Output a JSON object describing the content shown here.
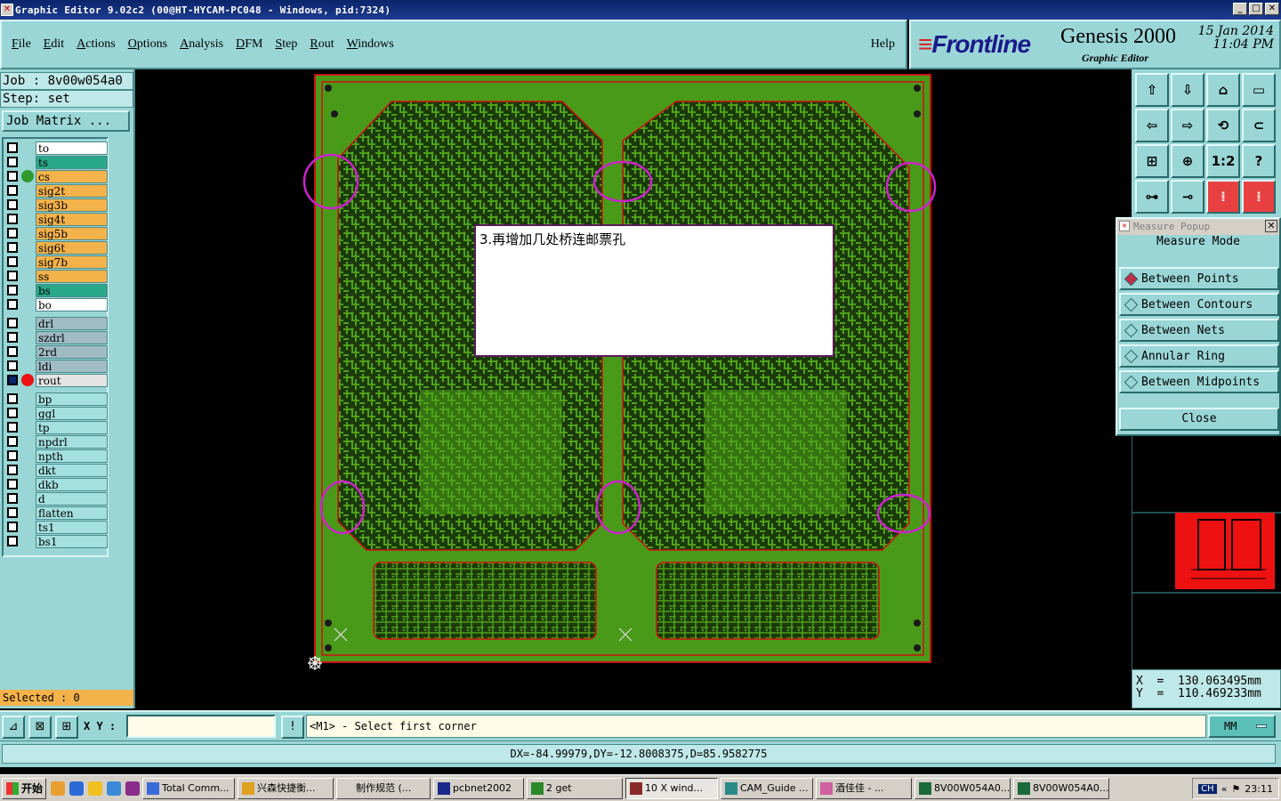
{
  "window": {
    "title": "Graphic Editor 9.02c2 (00@HT-HYCAM-PC048 - Windows, pid:7324)",
    "buttons": [
      "_",
      "□",
      "✕"
    ]
  },
  "menu": {
    "items": [
      "File",
      "Edit",
      "Actions",
      "Options",
      "Analysis",
      "DFM",
      "Step",
      "Rout",
      "Windows"
    ],
    "help": "Help"
  },
  "brand": {
    "logo": "Frontline",
    "product": "Genesis 2000",
    "subtitle": "Graphic Editor",
    "date": "15 Jan 2014",
    "time": "11:04 PM"
  },
  "job": {
    "job_line": "Job : 8v00w054a0",
    "step_line": "Step: set",
    "matrix_button": "Job Matrix ...",
    "selected": "Selected : 0"
  },
  "layers": [
    {
      "name": "to",
      "color": "#ffffff"
    },
    {
      "name": "ts",
      "color": "#2aa88a"
    },
    {
      "name": "cs",
      "color": "#f4b24a",
      "dot": "#2e9a2e"
    },
    {
      "name": "sig2t",
      "color": "#f4b24a"
    },
    {
      "name": "sig3b",
      "color": "#f4b24a"
    },
    {
      "name": "sig4t",
      "color": "#f4b24a"
    },
    {
      "name": "sig5b",
      "color": "#f4b24a"
    },
    {
      "name": "sig6t",
      "color": "#f4b24a"
    },
    {
      "name": "sig7b",
      "color": "#f4b24a"
    },
    {
      "name": "ss",
      "color": "#f4b24a"
    },
    {
      "name": "bs",
      "color": "#2aa88a"
    },
    {
      "name": "bo",
      "color": "#ffffff"
    },
    {
      "name": "drl",
      "color": "#9fbcc4"
    },
    {
      "name": "szdrl",
      "color": "#9fbcc4"
    },
    {
      "name": "2rd",
      "color": "#9fbcc4"
    },
    {
      "name": "ldi",
      "color": "#9fbcc4"
    },
    {
      "name": "rout",
      "color": "#e4e4e4",
      "dot": "#ee1111",
      "checked": true
    },
    {
      "name": "bp",
      "color": "#a4e0e0"
    },
    {
      "name": "ggl",
      "color": "#a4e0e0"
    },
    {
      "name": "tp",
      "color": "#a4e0e0"
    },
    {
      "name": "npdrl",
      "color": "#a4e0e0"
    },
    {
      "name": "npth",
      "color": "#a4e0e0"
    },
    {
      "name": "dkt",
      "color": "#a4e0e0"
    },
    {
      "name": "dkb",
      "color": "#a4e0e0"
    },
    {
      "name": "d",
      "color": "#a4e0e0"
    },
    {
      "name": "flatten",
      "color": "#a4e0e0"
    },
    {
      "name": "ts1",
      "color": "#a4e0e0"
    },
    {
      "name": "bs1",
      "color": "#a4e0e0"
    }
  ],
  "note": {
    "text": "3.再增加几处桥连邮票孔"
  },
  "toolbar_icons": [
    "zoom-home-icon",
    "zoom-in-icon",
    "zoom-fit-icon",
    "zoom-window-icon",
    "pan-left-icon",
    "pan-right-icon",
    "redraw-icon",
    "snap-icon",
    "fill-icon",
    "center-icon",
    "scale-icon",
    "help-icon",
    "measure-icon",
    "key-icon",
    "net-icon",
    "net-alt-icon"
  ],
  "toolbar_glyphs": [
    "⇧",
    "⇩",
    "⌂",
    "▭",
    "⇦",
    "⇨",
    "⟲",
    "⊂",
    "⊞",
    "⊕",
    "1:2",
    "?",
    "⊶",
    "⊸",
    "⁞",
    "⁞"
  ],
  "measure": {
    "title": "Measure Popup",
    "mode_label": "Measure Mode",
    "options": [
      "Between Points",
      "Between Contours",
      "Between Nets",
      "Annular Ring",
      "Between Midpoints"
    ],
    "selected_option": "Between Points",
    "close": "Close"
  },
  "coords": {
    "x_line": "X  =  130.063495mm",
    "y_line": "Y  =  110.469233mm"
  },
  "status": {
    "xy_label": "X Y :",
    "xy_value": "",
    "prompt_icon": "!",
    "prompt": "<M1> - Select first corner",
    "units": "MM",
    "measure_result": "DX=-84.99979,DY=-12.8008375,D=85.9582775"
  },
  "taskbar": {
    "start": "开始",
    "tasks": [
      "Total Comm...",
      "兴森快捷衡...",
      "制作规范 (...",
      "pcbnet2002",
      "2 get",
      "10 X wind...",
      "CAM_Guide ...",
      "酒佳佳 - ...",
      "8V00W054A0...",
      "8V00W054A0..."
    ],
    "active_task": "10 X wind...",
    "ime": "CH",
    "clock": "23:11"
  },
  "colors": {
    "panel": "#9ad6d6",
    "board": "#4a9a1a",
    "rout": "#cc1111",
    "highlight_circle": "#cc22cc"
  }
}
